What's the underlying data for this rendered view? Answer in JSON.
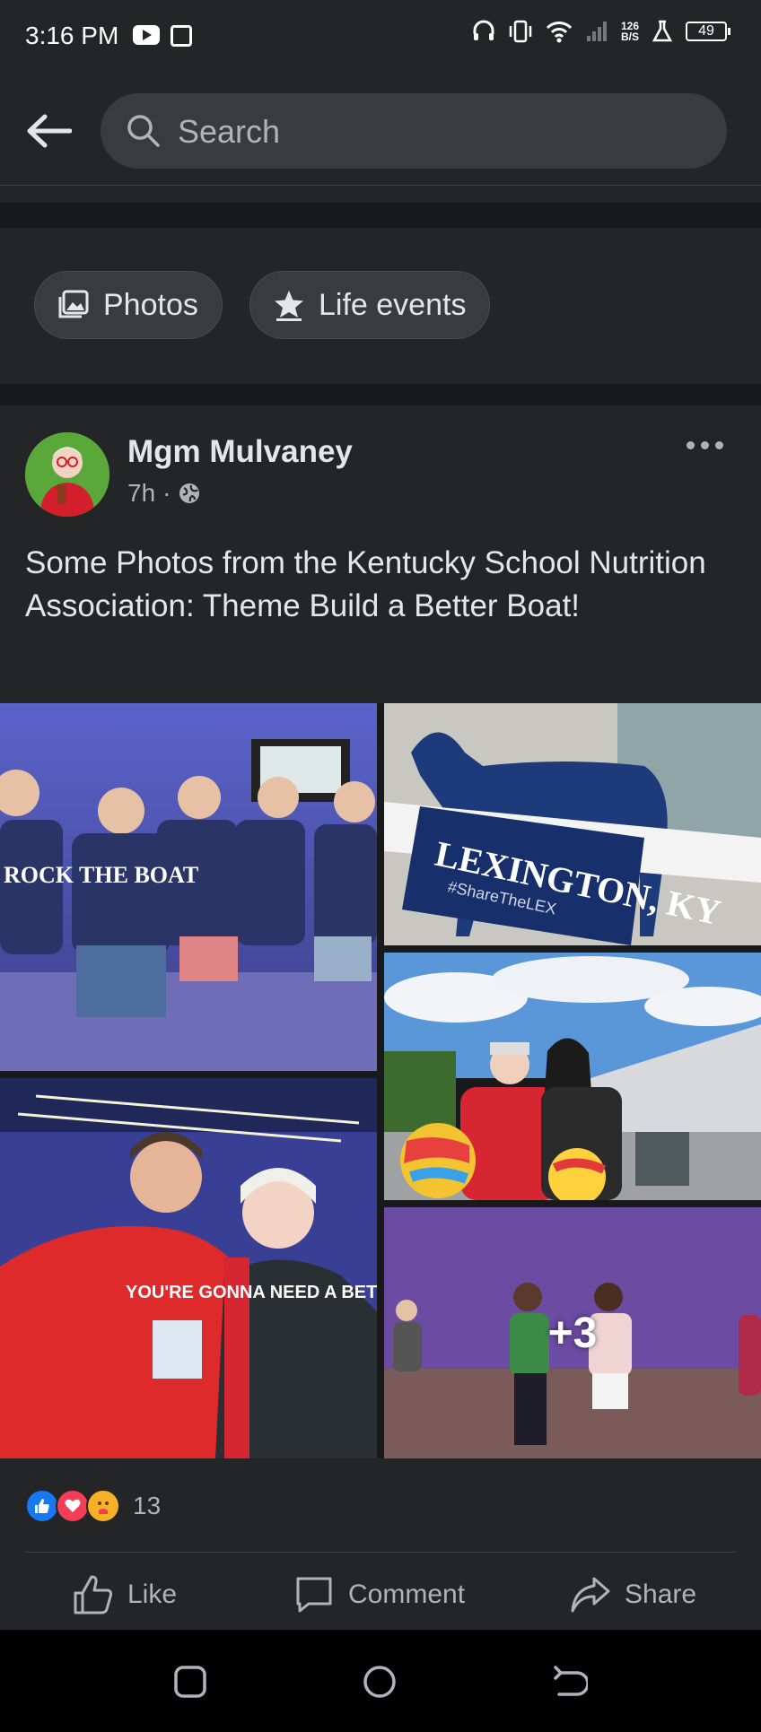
{
  "status_bar": {
    "time": "3:16 PM",
    "net_speed_top": "126",
    "net_speed_bottom": "B/S",
    "battery": "49"
  },
  "search": {
    "placeholder": "Search"
  },
  "filters": [
    {
      "label": "Photos",
      "icon": "photos-icon"
    },
    {
      "label": "Life events",
      "icon": "star-icon"
    }
  ],
  "post": {
    "author": "Mgm Mulvaney",
    "time": "7h",
    "privacy_icon": "globe-icon",
    "text": "Some Photos from the Kentucky School Nutrition Association: Theme Build a Better Boat!",
    "photos_more": "+3",
    "photo_captions": {
      "shirt_text": "ROCK THE BOAT",
      "sign_text": "LEXINGTON, KY",
      "sign_sub": "#ShareTheLEX",
      "red_shirt_text": "YOU'RE GONNA NEED A BETTER BOAT"
    },
    "reactions": {
      "icons": [
        "like-icon",
        "love-icon",
        "care-icon"
      ],
      "count": "13"
    },
    "actions": {
      "like": "Like",
      "comment": "Comment",
      "share": "Share"
    }
  },
  "colors": {
    "background": "#242526",
    "surface": "#3a3b3c",
    "text": "#e4e6eb",
    "muted": "#b0b3b8",
    "like_blue": "#1877f2",
    "love_red": "#f33e58"
  }
}
